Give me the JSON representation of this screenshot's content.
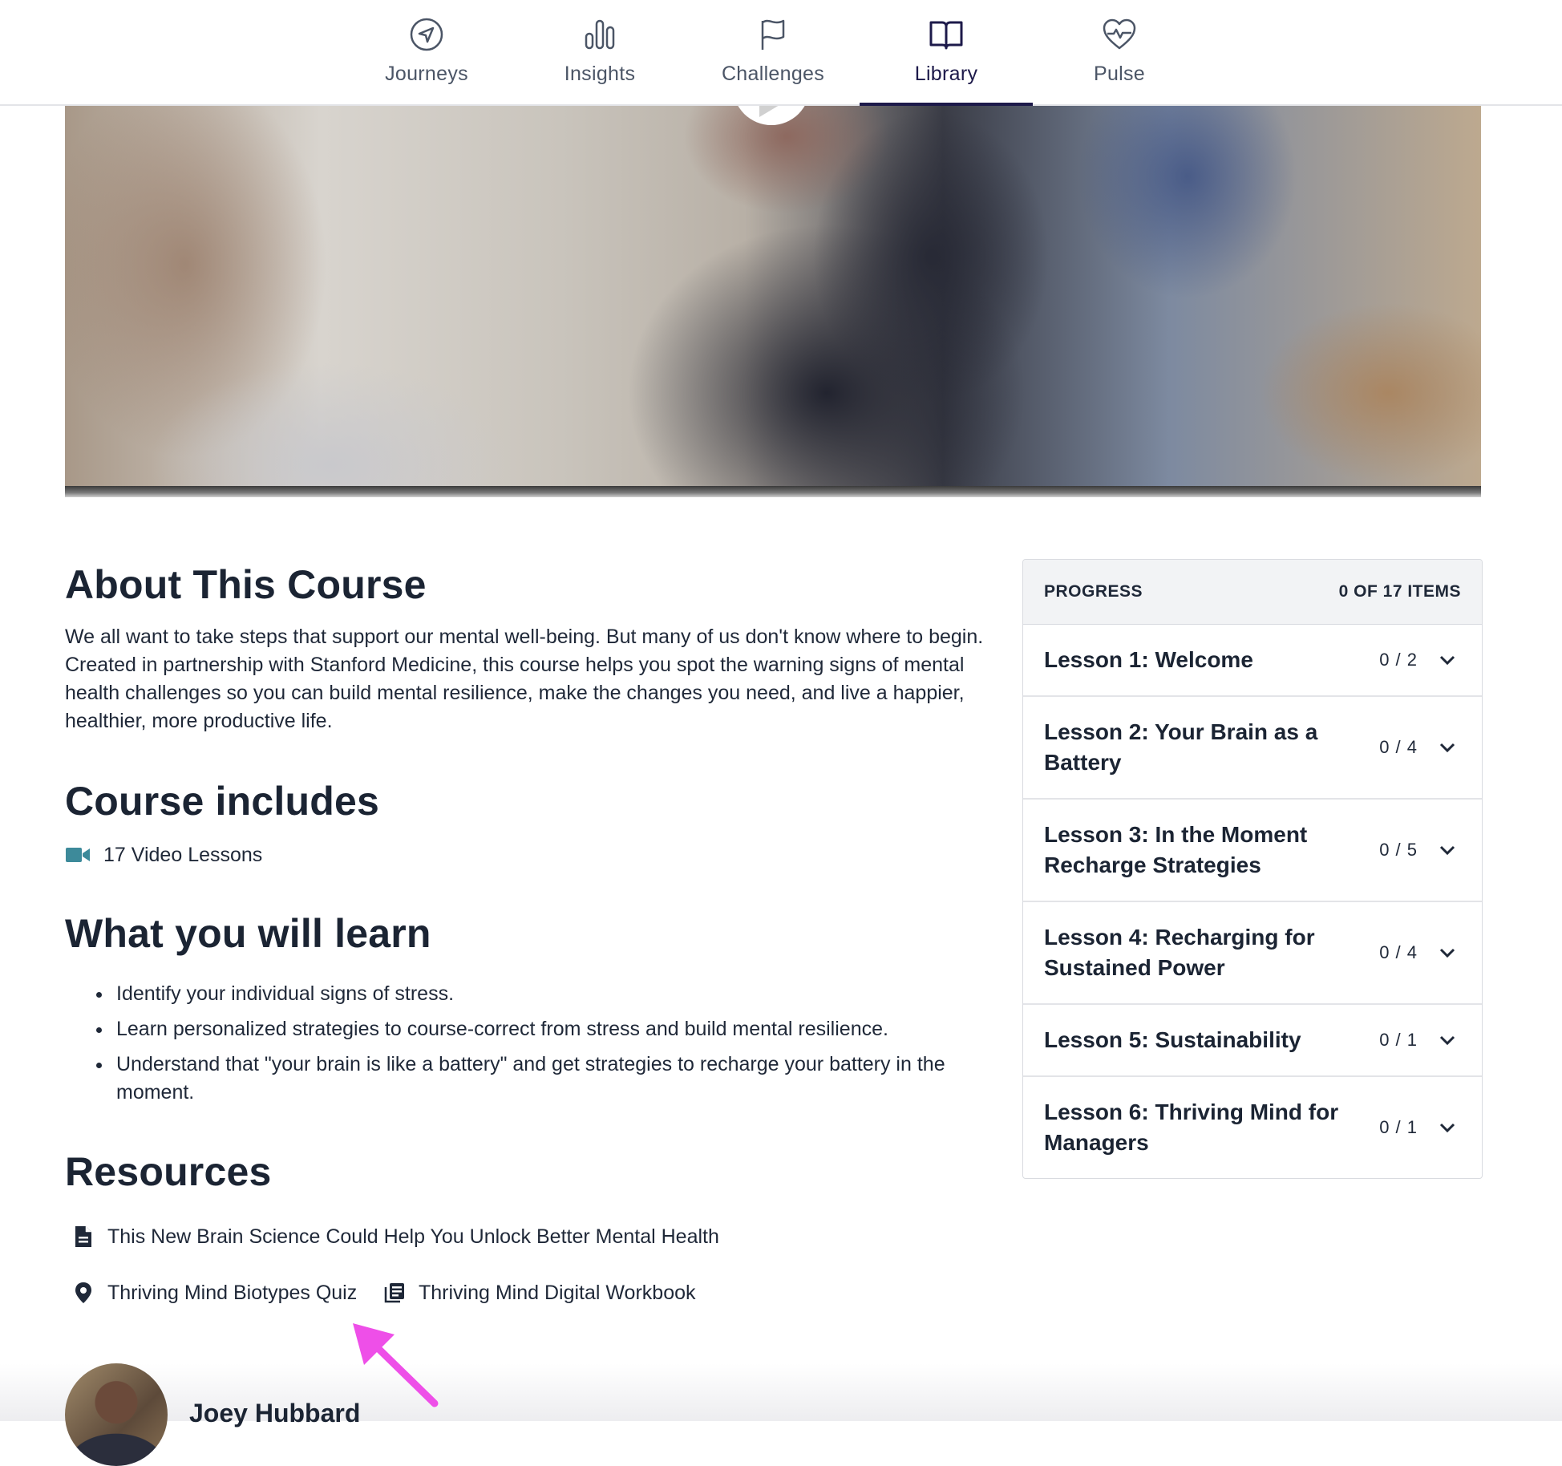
{
  "nav": {
    "items": [
      {
        "label": "Journeys",
        "icon": "navigation-arrow-icon"
      },
      {
        "label": "Insights",
        "icon": "bar-chart-icon"
      },
      {
        "label": "Challenges",
        "icon": "flag-icon"
      },
      {
        "label": "Library",
        "icon": "open-book-icon",
        "active": true
      },
      {
        "label": "Pulse",
        "icon": "heart-pulse-icon"
      }
    ],
    "active_color": "#1d1a4a"
  },
  "about": {
    "heading": "About This Course",
    "text": "We all want to take steps that support our mental well-being. But many of us don't know where to begin. Created in partnership with Stanford Medicine, this course helps you spot the warning signs of mental health challenges so you can build mental resilience, make the changes you need, and live a happier, healthier, more productive life."
  },
  "includes": {
    "heading": "Course includes",
    "video_lessons": "17 Video Lessons",
    "icon_color": "#3d8a9a"
  },
  "learn": {
    "heading": "What you will learn",
    "items": [
      "Identify your individual signs of stress.",
      "Learn personalized strategies to course-correct from stress and build mental resilience.",
      "Understand that \"your brain is like a battery\" and get strategies to recharge your battery in the moment."
    ]
  },
  "resources": {
    "heading": "Resources",
    "article": "This New Brain Science Could Help You Unlock Better Mental Health",
    "quiz": "Thriving Mind Biotypes Quiz",
    "workbook": "Thriving Mind Digital Workbook"
  },
  "progress": {
    "label": "PROGRESS",
    "summary": "0 OF 17 ITEMS",
    "lessons": [
      {
        "title": "Lesson 1: Welcome",
        "count": "0 / 2"
      },
      {
        "title": "Lesson 2: Your Brain as a Battery",
        "count": "0 / 4"
      },
      {
        "title": "Lesson 3: In the Moment Recharge Strategies",
        "count": "0 / 5"
      },
      {
        "title": "Lesson 4: Recharging for Sustained Power",
        "count": "0 / 4"
      },
      {
        "title": "Lesson 5: Sustainability",
        "count": "0 / 1"
      },
      {
        "title": "Lesson 6: Thriving Mind for Managers",
        "count": "0 / 1"
      }
    ]
  },
  "instructor": {
    "name": "Joey Hubbard"
  },
  "annotation": {
    "arrow_color": "#ee4fe8"
  }
}
